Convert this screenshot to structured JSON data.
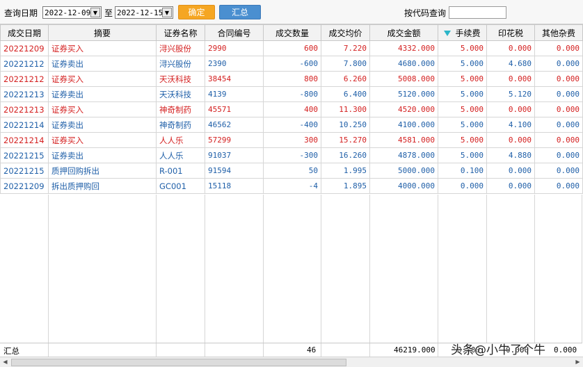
{
  "toolbar": {
    "query_date_label": "查询日期",
    "start_date": "2022-12-09",
    "to_label": "至",
    "end_date": "2022-12-15",
    "confirm_button": "确定",
    "summary_button": "汇总",
    "code_query_label": "按代码查询",
    "code_query_value": ""
  },
  "table": {
    "columns": [
      "成交日期",
      "摘要",
      "证券名称",
      "合同编号",
      "成交数量",
      "成交均价",
      "成交金额",
      "手续费",
      "印花税",
      "其他杂费"
    ],
    "rows": [
      {
        "color": "red",
        "cells": [
          "20221209",
          "证券买入",
          "浔兴股份",
          "2990",
          "600",
          "7.220",
          "4332.000",
          "5.000",
          "0.000",
          "0.000"
        ]
      },
      {
        "color": "blue",
        "cells": [
          "20221212",
          "证券卖出",
          "浔兴股份",
          "2390",
          "-600",
          "7.800",
          "4680.000",
          "5.000",
          "4.680",
          "0.000"
        ]
      },
      {
        "color": "red",
        "cells": [
          "20221212",
          "证券买入",
          "天沃科技",
          "38454",
          "800",
          "6.260",
          "5008.000",
          "5.000",
          "0.000",
          "0.000"
        ]
      },
      {
        "color": "blue",
        "cells": [
          "20221213",
          "证券卖出",
          "天沃科技",
          "4139",
          "-800",
          "6.400",
          "5120.000",
          "5.000",
          "5.120",
          "0.000"
        ]
      },
      {
        "color": "red",
        "cells": [
          "20221213",
          "证券买入",
          "神奇制药",
          "45571",
          "400",
          "11.300",
          "4520.000",
          "5.000",
          "0.000",
          "0.000"
        ]
      },
      {
        "color": "blue",
        "cells": [
          "20221214",
          "证券卖出",
          "神奇制药",
          "46562",
          "-400",
          "10.250",
          "4100.000",
          "5.000",
          "4.100",
          "0.000"
        ]
      },
      {
        "color": "red",
        "cells": [
          "20221214",
          "证券买入",
          "人人乐",
          "57299",
          "300",
          "15.270",
          "4581.000",
          "5.000",
          "0.000",
          "0.000"
        ]
      },
      {
        "color": "blue",
        "cells": [
          "20221215",
          "证券卖出",
          "人人乐",
          "91037",
          "-300",
          "16.260",
          "4878.000",
          "5.000",
          "4.880",
          "0.000"
        ]
      },
      {
        "color": "blue",
        "cells": [
          "20221215",
          "质押回购拆出",
          "R-001",
          "91594",
          "50",
          "1.995",
          "5000.000",
          "0.100",
          "0.000",
          "0.000"
        ]
      },
      {
        "color": "blue",
        "cells": [
          "20221209",
          "拆出质押购回",
          "GC001",
          "15118",
          "-4",
          "1.895",
          "4000.000",
          "0.000",
          "0.000",
          "0.000"
        ]
      }
    ],
    "summary": {
      "label": "汇总",
      "quantity": "46",
      "amount": "46219.000",
      "fee": "0.000",
      "stamp": "0.000",
      "other": "0.000"
    }
  },
  "watermark": "头条@小牛了个牛",
  "colors": {
    "buy": "#d42020",
    "sell": "#1f5fa8",
    "confirm": "#f5a623",
    "summary_btn": "#4a8fd0"
  }
}
